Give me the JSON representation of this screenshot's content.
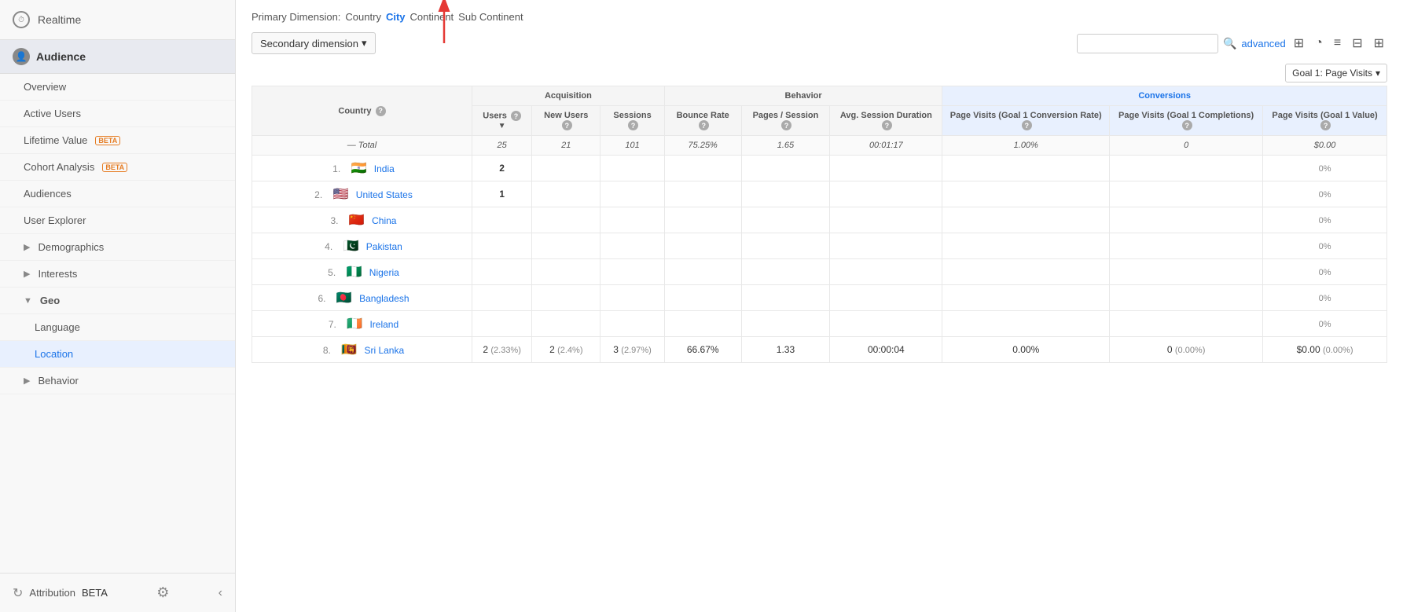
{
  "sidebar": {
    "realtime_label": "Realtime",
    "audience_label": "Audience",
    "items": [
      {
        "id": "overview",
        "label": "Overview",
        "indent": false,
        "beta": false,
        "arrow": false,
        "active": false
      },
      {
        "id": "active-users",
        "label": "Active Users",
        "indent": false,
        "beta": false,
        "arrow": false,
        "active": false
      },
      {
        "id": "lifetime-value",
        "label": "Lifetime Value",
        "indent": false,
        "beta": true,
        "arrow": false,
        "active": false
      },
      {
        "id": "cohort-analysis",
        "label": "Cohort Analysis",
        "indent": false,
        "beta": true,
        "arrow": false,
        "active": false
      },
      {
        "id": "audiences",
        "label": "Audiences",
        "indent": false,
        "beta": false,
        "arrow": false,
        "active": false
      },
      {
        "id": "user-explorer",
        "label": "User Explorer",
        "indent": false,
        "beta": false,
        "arrow": false,
        "active": false
      },
      {
        "id": "demographics",
        "label": "Demographics",
        "indent": false,
        "beta": false,
        "arrow": true,
        "active": false
      },
      {
        "id": "interests",
        "label": "Interests",
        "indent": false,
        "beta": false,
        "arrow": true,
        "active": false
      },
      {
        "id": "geo",
        "label": "Geo",
        "indent": false,
        "beta": false,
        "arrow": true,
        "active": true,
        "open": true
      },
      {
        "id": "language",
        "label": "Language",
        "indent": true,
        "beta": false,
        "arrow": false,
        "active": false
      },
      {
        "id": "location",
        "label": "Location",
        "indent": true,
        "beta": false,
        "arrow": false,
        "active": true
      },
      {
        "id": "behavior",
        "label": "Behavior",
        "indent": false,
        "beta": false,
        "arrow": true,
        "active": false
      }
    ],
    "attribution_label": "Attribution",
    "attribution_beta": "BETA",
    "collapse_label": "‹",
    "settings_label": "⚙"
  },
  "primary_dimension": {
    "label": "Primary Dimension:",
    "options": [
      {
        "id": "country",
        "label": "Country",
        "active": false
      },
      {
        "id": "city",
        "label": "City",
        "active": true
      },
      {
        "id": "continent",
        "label": "Continent",
        "active": false
      },
      {
        "id": "sub-continent",
        "label": "Sub Continent",
        "active": false
      }
    ]
  },
  "toolbar": {
    "secondary_dim_label": "Secondary dimension",
    "search_placeholder": "",
    "advanced_label": "advanced"
  },
  "table": {
    "goal_dropdown_label": "Goal 1: Page Visits",
    "columns": {
      "country": "Country",
      "acquisition": "Acquisition",
      "behavior": "Behavior",
      "conversions": "Conversions",
      "users": "Users",
      "new_users": "New Users",
      "sessions": "Sessions",
      "bounce_rate": "Bounce Rate",
      "pages_session": "Pages / Session",
      "avg_session": "Avg. Session Duration",
      "page_visits_rate": "Page Visits (Goal 1 Conversion Rate)",
      "page_visits_completions": "Page Visits (Goal 1 Completions)",
      "page_visits_value": "Page Visits (Goal 1 Value)"
    },
    "total_row": {
      "label": "Total",
      "users": "25",
      "users_pct": "",
      "new_users": "21",
      "new_users_pct": "",
      "sessions": "101",
      "sessions_pct": "",
      "bounce_rate": "75.25%",
      "pages_session": "1.65",
      "avg_session": "00:01:17",
      "rate": "1.00%",
      "completions": "0",
      "value": "$0.00"
    },
    "rows": [
      {
        "num": 1,
        "flag": "🇮🇳",
        "country": "India",
        "country_link": true,
        "users": "2",
        "users_pct": "",
        "new_users": "",
        "new_users_pct": "",
        "sessions": "",
        "bounce_rate": "",
        "pages_session": "",
        "avg_session": "",
        "rate": "",
        "completions": "",
        "value": "0%"
      },
      {
        "num": 2,
        "flag": "🇺🇸",
        "country": "United States",
        "country_link": true,
        "users": "1",
        "users_pct": "",
        "new_users": "",
        "new_users_pct": "",
        "sessions": "",
        "bounce_rate": "",
        "pages_session": "",
        "avg_session": "",
        "rate": "",
        "completions": "",
        "value": "0%"
      },
      {
        "num": 3,
        "flag": "🇨🇳",
        "country": "China",
        "country_link": true,
        "users": "",
        "new_users": "",
        "sessions": "",
        "bounce_rate": "",
        "pages_session": "",
        "avg_session": "",
        "rate": "",
        "completions": "",
        "value": "0%"
      },
      {
        "num": 4,
        "flag": "🇵🇰",
        "country": "Pakistan",
        "country_link": true,
        "users": "",
        "new_users": "",
        "sessions": "",
        "bounce_rate": "",
        "pages_session": "",
        "avg_session": "",
        "rate": "",
        "completions": "",
        "value": "0%"
      },
      {
        "num": 5,
        "flag": "🇳🇬",
        "country": "Nigeria",
        "country_link": true,
        "users": "",
        "new_users": "",
        "sessions": "",
        "bounce_rate": "",
        "pages_session": "",
        "avg_session": "",
        "rate": "",
        "completions": "",
        "value": "0%"
      },
      {
        "num": 6,
        "flag": "🇧🇩",
        "country": "Bangladesh",
        "country_link": true,
        "users": "",
        "new_users": "",
        "sessions": "",
        "bounce_rate": "",
        "pages_session": "",
        "avg_session": "",
        "rate": "",
        "completions": "",
        "value": "0%"
      },
      {
        "num": 7,
        "flag": "🇮🇪",
        "country": "Ireland",
        "country_link": true,
        "users": "",
        "new_users": "",
        "sessions": "",
        "bounce_rate": "",
        "pages_session": "",
        "avg_session": "",
        "rate": "",
        "completions": "",
        "value": "0%"
      },
      {
        "num": 8,
        "flag": "🇱🇰",
        "country": "Sri Lanka",
        "country_link": true,
        "users": "2",
        "users_pct": "(2.33%)",
        "new_users": "2",
        "new_users_pct": "(2.4%)",
        "sessions": "3",
        "sessions_pct": "(2.97%)",
        "bounce_rate": "66.67%",
        "pages_session": "1.33",
        "avg_session": "00:00:04",
        "rate": "0.00%",
        "completions": "0",
        "completions_pct": "(0.00%)",
        "value": "$0.00",
        "value_pct": "(0.00%)"
      }
    ]
  },
  "icons": {
    "search": "🔍",
    "dropdown": "▾",
    "sort_down": "▼",
    "grid": "⊞",
    "pie": "◔",
    "list": "≡",
    "adjust": "⊟",
    "table": "⊟",
    "gear": "⚙",
    "back": "‹",
    "collapse": "‹",
    "attribution": "↻",
    "realtime": "⏱",
    "help": "?"
  }
}
